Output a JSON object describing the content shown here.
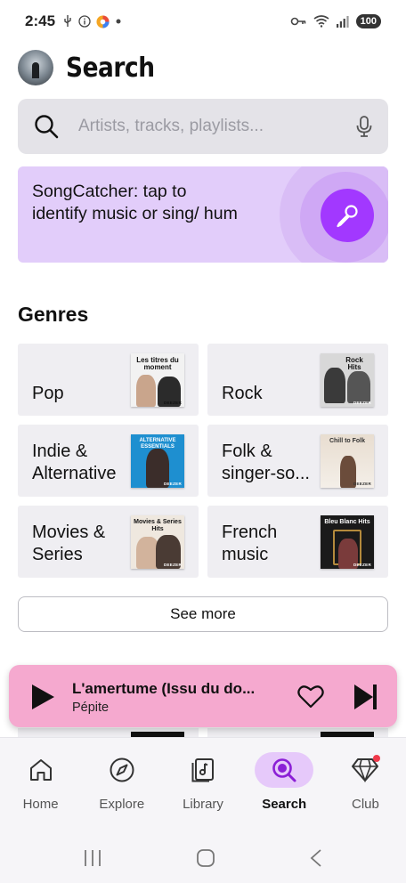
{
  "status_bar": {
    "time": "2:45",
    "battery": "100",
    "left_icons": [
      "usb-icon",
      "info-icon",
      "app-icon",
      "dot-icon"
    ],
    "right_icons": [
      "key-icon",
      "wifi-icon",
      "signal-icon"
    ]
  },
  "header": {
    "title": "Search"
  },
  "search": {
    "placeholder": "Artists, tracks, playlists..."
  },
  "songcatcher": {
    "text": "SongCatcher: tap to identify music or sing/ hum",
    "accent": "#a238ff"
  },
  "genres": {
    "title": "Genres",
    "items": [
      {
        "label": "Pop",
        "art_caption": "Les titres du moment"
      },
      {
        "label": "Rock",
        "art_caption": "Rock Hits"
      },
      {
        "label": "Indie & Alternative",
        "art_caption": "ALTERNATIVE ESSENTIALS"
      },
      {
        "label": "Folk & singer-so...",
        "art_caption": "Chill to Folk"
      },
      {
        "label": "Movies & Series",
        "art_caption": "Movies & Series Hits"
      },
      {
        "label": "French music",
        "art_caption": "Bleu Blanc Hits"
      }
    ],
    "art_brand": "DEEZER",
    "see_more": "See more"
  },
  "player": {
    "title": "L'amertume (Issu du do...",
    "artist": "Pépite",
    "background": "#f5a9cf"
  },
  "bottom_nav": {
    "items": [
      {
        "label": "Home",
        "icon": "home-icon",
        "active": false
      },
      {
        "label": "Explore",
        "icon": "compass-icon",
        "active": false
      },
      {
        "label": "Library",
        "icon": "library-icon",
        "active": false
      },
      {
        "label": "Search",
        "icon": "search-icon",
        "active": true
      },
      {
        "label": "Club",
        "icon": "diamond-icon",
        "active": false
      }
    ]
  }
}
